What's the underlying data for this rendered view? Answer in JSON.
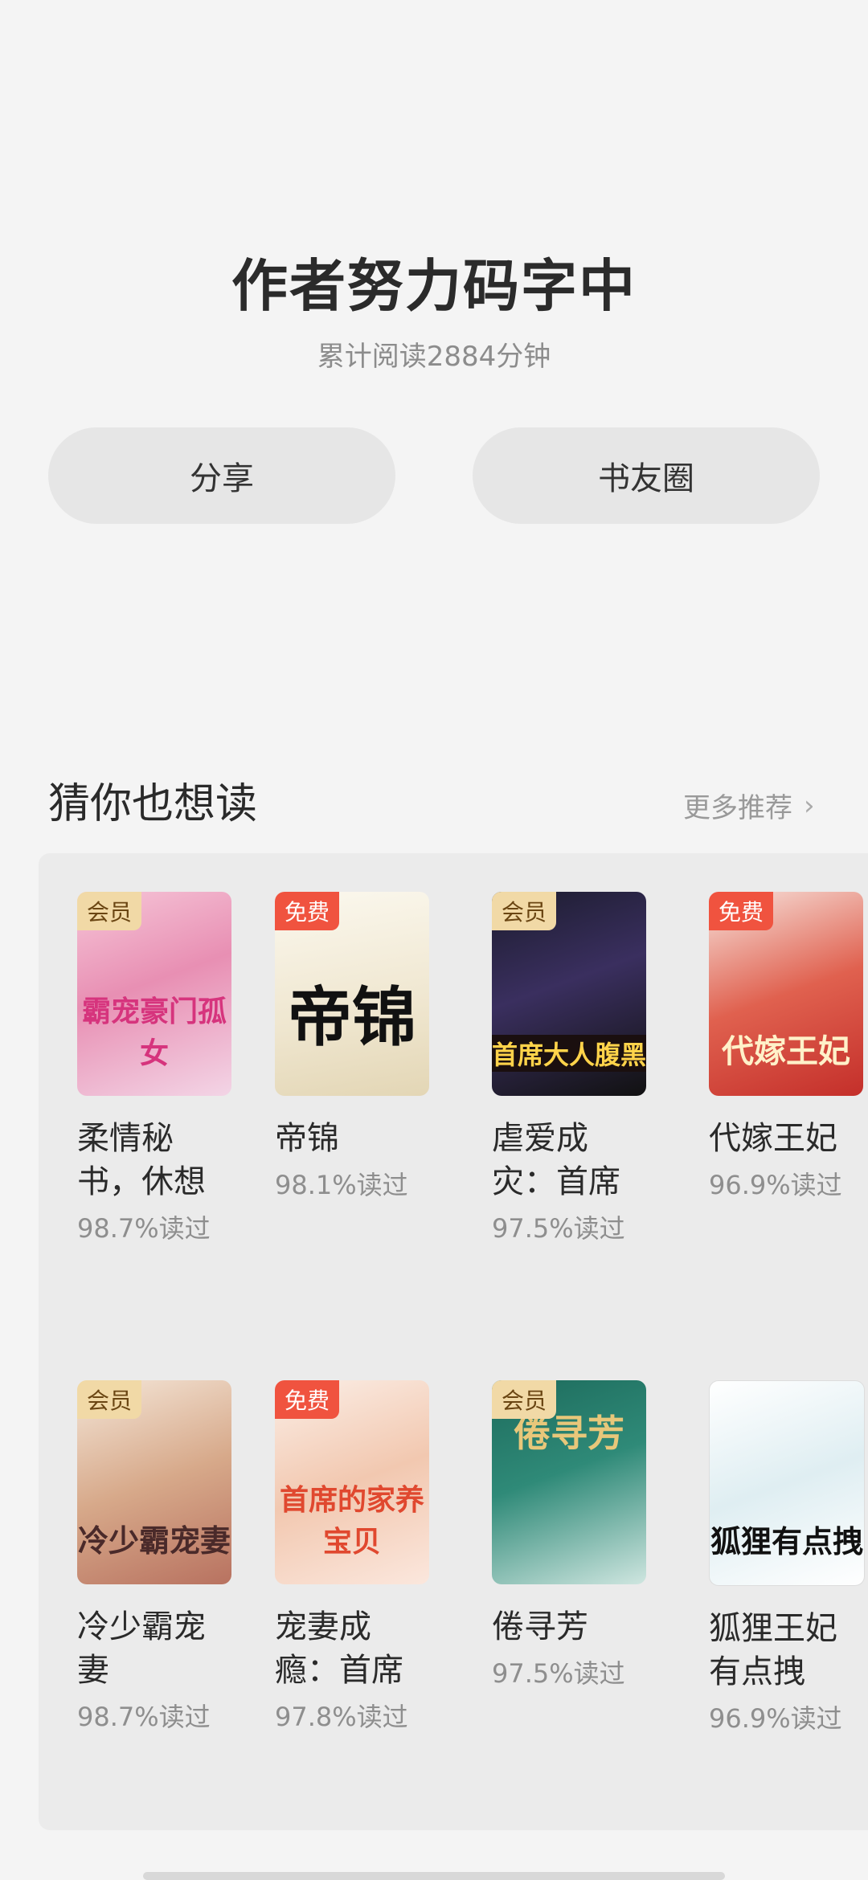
{
  "header": {
    "title": "作者努力码字中",
    "subtitle": "累计阅读2884分钟"
  },
  "actions": {
    "share_label": "分享",
    "circle_label": "书友圈"
  },
  "recommend": {
    "title": "猜你也想读",
    "more_label": "更多推荐"
  },
  "books": [
    {
      "name": "柔情秘书，休想",
      "rate": "98.7%读过",
      "badge": "会员",
      "cover_text": "霸宠豪门孤女"
    },
    {
      "name": "帝锦",
      "rate": "98.1%读过",
      "badge": "免费",
      "cover_text": "帝锦"
    },
    {
      "name": "虐爱成灾：首席",
      "rate": "97.5%读过",
      "badge": "会员",
      "cover_text": "首席大人腹黑"
    },
    {
      "name": "代嫁王妃",
      "rate": "96.9%读过",
      "badge": "免费",
      "cover_text": "代嫁王妃"
    },
    {
      "name": "冷少霸宠妻",
      "rate": "98.7%读过",
      "badge": "会员",
      "cover_text": "冷少霸宠妻"
    },
    {
      "name": "宠妻成瘾：首席",
      "rate": "97.8%读过",
      "badge": "免费",
      "cover_text": "首席的家养宝贝"
    },
    {
      "name": "倦寻芳",
      "rate": "97.5%读过",
      "badge": "会员",
      "cover_text": "倦寻芳"
    },
    {
      "name": "狐狸王妃有点拽",
      "rate": "96.9%读过",
      "badge": "",
      "cover_text": "狐狸有点拽"
    }
  ]
}
